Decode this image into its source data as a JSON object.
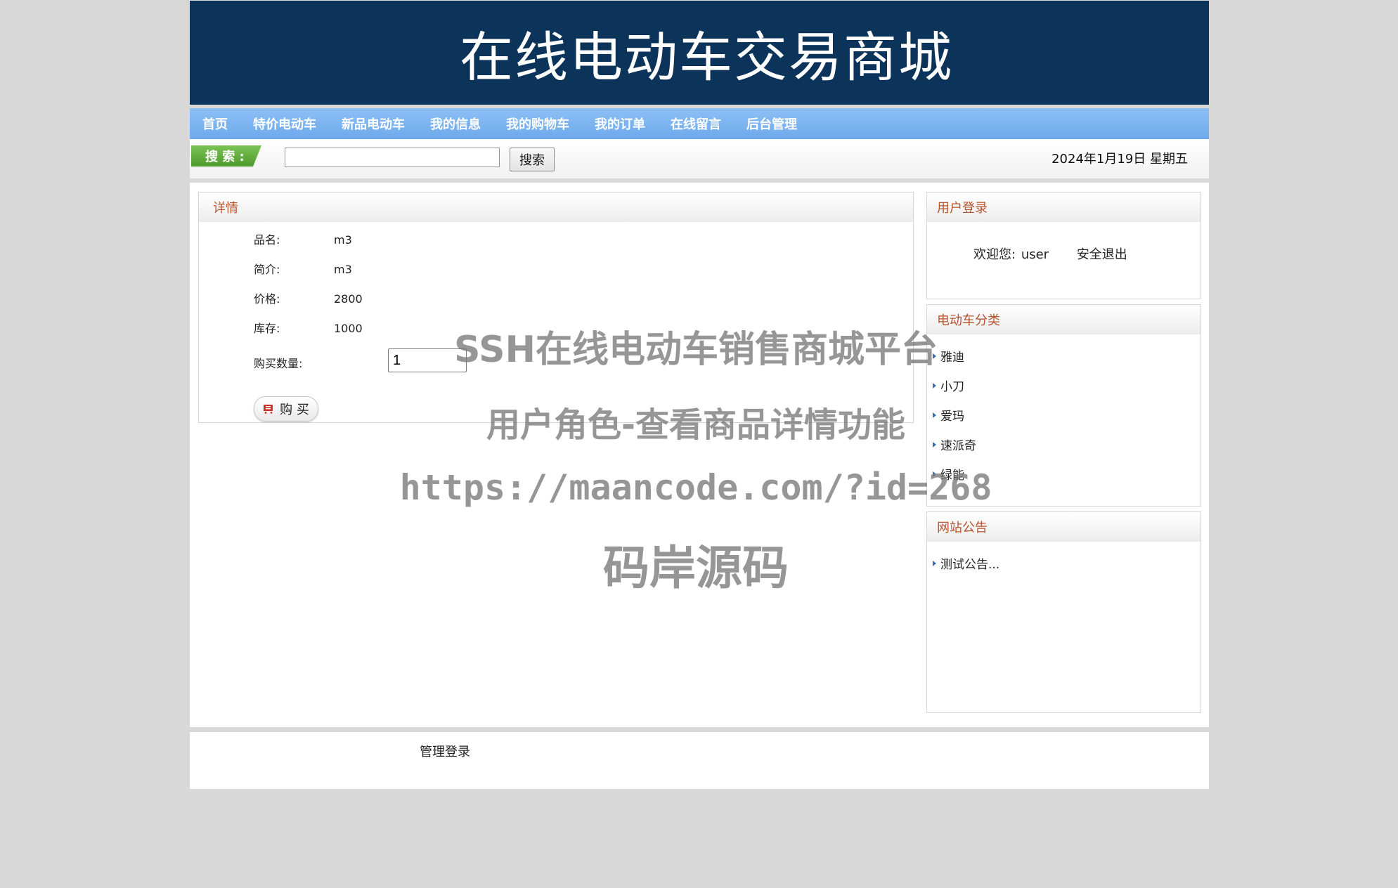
{
  "header": {
    "title": "在线电动车交易商城"
  },
  "nav": {
    "items": [
      "首页",
      "特价电动车",
      "新品电动车",
      "我的信息",
      "我的购物车",
      "我的订单",
      "在线留言",
      "后台管理"
    ]
  },
  "search": {
    "tag_label": "搜 索 :",
    "value": "",
    "button_label": "搜索",
    "date": "2024年1月19日 星期五"
  },
  "detail": {
    "heading": "详情",
    "fields": [
      {
        "label": "品名:",
        "value": "m3"
      },
      {
        "label": "简介:",
        "value": "m3"
      },
      {
        "label": "价格:",
        "value": "2800"
      },
      {
        "label": "库存:",
        "value": "1000"
      }
    ],
    "qty_label": "购买数量:",
    "qty_value": "1",
    "buy_label": "购 买"
  },
  "login": {
    "heading": "用户登录",
    "welcome": "欢迎您:",
    "username": "user",
    "logout": "安全退出"
  },
  "categories": {
    "heading": "电动车分类",
    "items": [
      "雅迪",
      "小刀",
      "爱玛",
      "速派奇",
      "绿能"
    ]
  },
  "notices": {
    "heading": "网站公告",
    "items": [
      "测试公告..."
    ]
  },
  "footer": {
    "admin_login": "管理登录"
  },
  "watermark": {
    "line1": "SSH在线电动车销售商城平台",
    "line2": "用户角色-查看商品详情功能",
    "line3": "https://maancode.com/?id=268",
    "line4": "码岸源码"
  },
  "colors": {
    "banner": "#0c3359",
    "nav": "#7cb4ef",
    "panel_heading": "#b5552e"
  }
}
